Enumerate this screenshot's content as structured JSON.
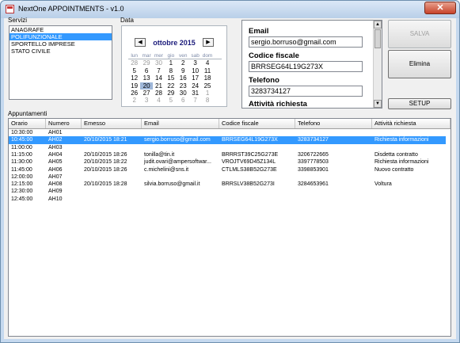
{
  "window": {
    "title": "NextOne APPOINTMENTS - v1.0",
    "close_glyph": "✕"
  },
  "servizi": {
    "label": "Servizi",
    "items": [
      "ANAGRAFE",
      "POLIFUNZIONALE",
      "SPORTELLO IMPRESE",
      "STATO CIVILE"
    ],
    "selected": "POLIFUNZIONALE"
  },
  "data_panel": {
    "label": "Data",
    "month_title": "ottobre 2015",
    "prev_glyph": "◀",
    "next_glyph": "▶",
    "day_names": [
      "lun",
      "mar",
      "mer",
      "gio",
      "ven",
      "sab",
      "dom"
    ],
    "weeks": [
      [
        "28",
        "29",
        "30",
        "1",
        "2",
        "3",
        "4"
      ],
      [
        "5",
        "6",
        "7",
        "8",
        "9",
        "10",
        "11"
      ],
      [
        "12",
        "13",
        "14",
        "15",
        "16",
        "17",
        "18"
      ],
      [
        "19",
        "20",
        "21",
        "22",
        "23",
        "24",
        "25"
      ],
      [
        "26",
        "27",
        "28",
        "29",
        "30",
        "31",
        "1"
      ],
      [
        "2",
        "3",
        "4",
        "5",
        "6",
        "7",
        "8"
      ]
    ],
    "today": "20"
  },
  "detail": {
    "email_label": "Email",
    "email_value": "sergio.borruso@gmail.com",
    "cf_label": "Codice fiscale",
    "cf_value": "BRRSEG64L19G273X",
    "phone_label": "Telefono",
    "phone_value": "3283734127",
    "activity_label": "Attività richiesta"
  },
  "buttons": {
    "salva": "SALVA",
    "elimina": "Elimina",
    "setup": "SETUP"
  },
  "appuntamenti": {
    "label": "Appuntamenti",
    "columns": [
      "Orario",
      "Numero",
      "Emesso",
      "Email",
      "Codice fiscale",
      "Telefono",
      "Attività richiesta"
    ],
    "rows": [
      {
        "orario": "10:30:00",
        "numero": "AH01",
        "emesso": "",
        "email": "",
        "cf": "",
        "tel": "",
        "attivita": ""
      },
      {
        "orario": "10:45:00",
        "numero": "AH02",
        "emesso": "20/10/2015 18:21",
        "email": "sergio.borruso@gmail.com",
        "cf": "BRRSEG64L19G273X",
        "tel": "3283734127",
        "attivita": "Richiesta informazioni"
      },
      {
        "orario": "11:00:00",
        "numero": "AH03",
        "emesso": "",
        "email": "",
        "cf": "",
        "tel": "",
        "attivita": ""
      },
      {
        "orario": "11:15:00",
        "numero": "AH04",
        "emesso": "20/10/2015 18:26",
        "email": "tonilla@tin.it",
        "cf": "BRRRST39C25G273E",
        "tel": "3206722665",
        "attivita": "Disdetta contratto"
      },
      {
        "orario": "11:30:00",
        "numero": "AH05",
        "emesso": "20/10/2015 18:22",
        "email": "judit.ovari@ampersoftwar...",
        "cf": "VROJTV69D45Z134L",
        "tel": "3397778503",
        "attivita": "Richiesta informazioni"
      },
      {
        "orario": "11:45:00",
        "numero": "AH06",
        "emesso": "20/10/2015 18:26",
        "email": "c.michelini@sns.it",
        "cf": "CTLMLS38B52G273E",
        "tel": "3398853901",
        "attivita": "Nuovo contratto"
      },
      {
        "orario": "12:00:00",
        "numero": "AH07",
        "emesso": "",
        "email": "",
        "cf": "",
        "tel": "",
        "attivita": ""
      },
      {
        "orario": "12:15:00",
        "numero": "AH08",
        "emesso": "20/10/2015 18:28",
        "email": "silvia.borruso@gmail.it",
        "cf": "BRRSLV38B52G273I",
        "tel": "3284653961",
        "attivita": "Voltura"
      },
      {
        "orario": "12:30:00",
        "numero": "AH09",
        "emesso": "",
        "email": "",
        "cf": "",
        "tel": "",
        "attivita": ""
      },
      {
        "orario": "12:45:00",
        "numero": "AH10",
        "emesso": "",
        "email": "",
        "cf": "",
        "tel": "",
        "attivita": ""
      }
    ],
    "selected_index": 1
  },
  "colors": {
    "selection": "#3399ff",
    "frame": "#c5d9ef"
  }
}
